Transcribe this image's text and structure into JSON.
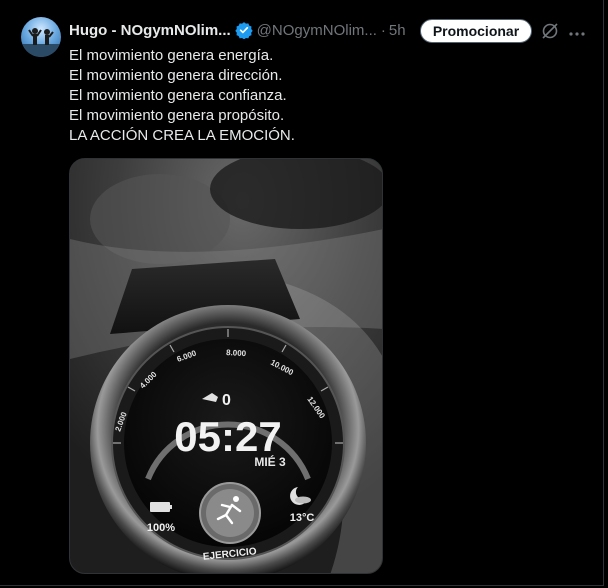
{
  "tweet": {
    "display_name": "Hugo - NOgymNOlim...",
    "handle": "@NOgymNOlim...",
    "separator": "·",
    "time": "5h",
    "promote_label": "Promocionar",
    "lines": [
      "El movimiento genera energía.",
      "El movimiento genera dirección.",
      "El movimiento genera confianza.",
      "El movimiento genera propósito.",
      "LA ACCIÓN CREA LA EMOCIÓN."
    ]
  },
  "watch": {
    "time": "05:27",
    "date": "MIÉ 3",
    "steps": "0",
    "scale": [
      "2.000",
      "4.000",
      "6.000",
      "8.000",
      "10.000",
      "12.000"
    ],
    "battery": "100%",
    "temperature": "13°C",
    "exercise_label": "EJERCICIO"
  },
  "colors": {
    "verified": "#1d9bf0",
    "muted": "#71767b",
    "text": "#e7e9ea",
    "background": "#000000"
  },
  "icons": [
    "verified-badge-icon",
    "grok-icon",
    "more-icon",
    "running-icon",
    "battery-icon",
    "weather-moon-icon",
    "shoe-icon"
  ]
}
